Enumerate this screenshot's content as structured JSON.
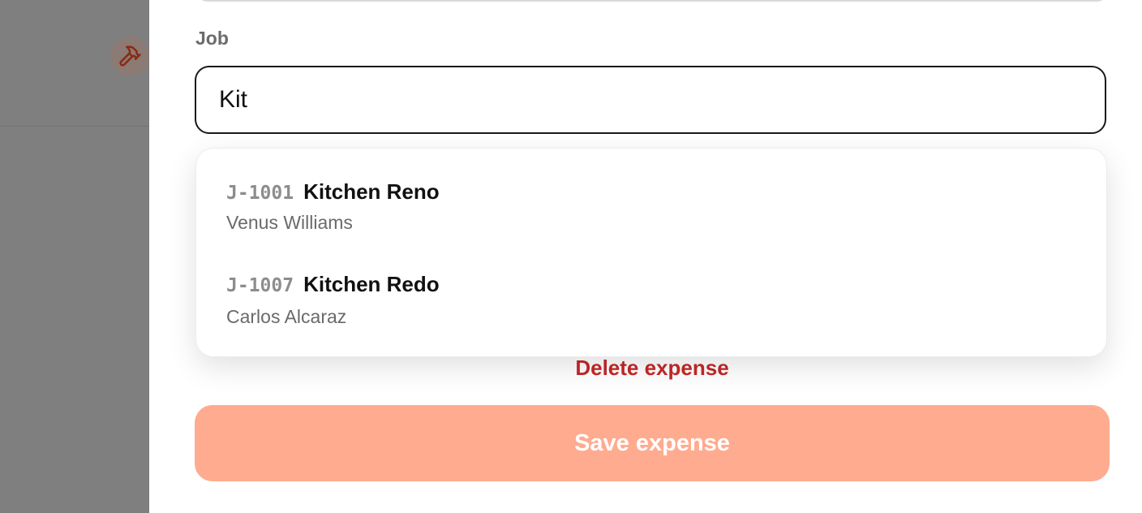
{
  "colors": {
    "accent": "#ffab8f",
    "danger": "#c62828",
    "backdrop": "#7f7f7f",
    "avatar_icon": "#8b2a10"
  },
  "backdrop": {
    "avatar_icon": "hammer-icon"
  },
  "form": {
    "job_label": "Job",
    "job_input_value": "Kit"
  },
  "dropdown": {
    "options": [
      {
        "code": "J-1001",
        "name": "Kitchen Reno",
        "client": "Venus Williams"
      },
      {
        "code": "J-1007",
        "name": "Kitchen Redo",
        "client": "Carlos Alcaraz"
      }
    ]
  },
  "actions": {
    "delete_label": "Delete expense",
    "save_label": "Save expense"
  }
}
